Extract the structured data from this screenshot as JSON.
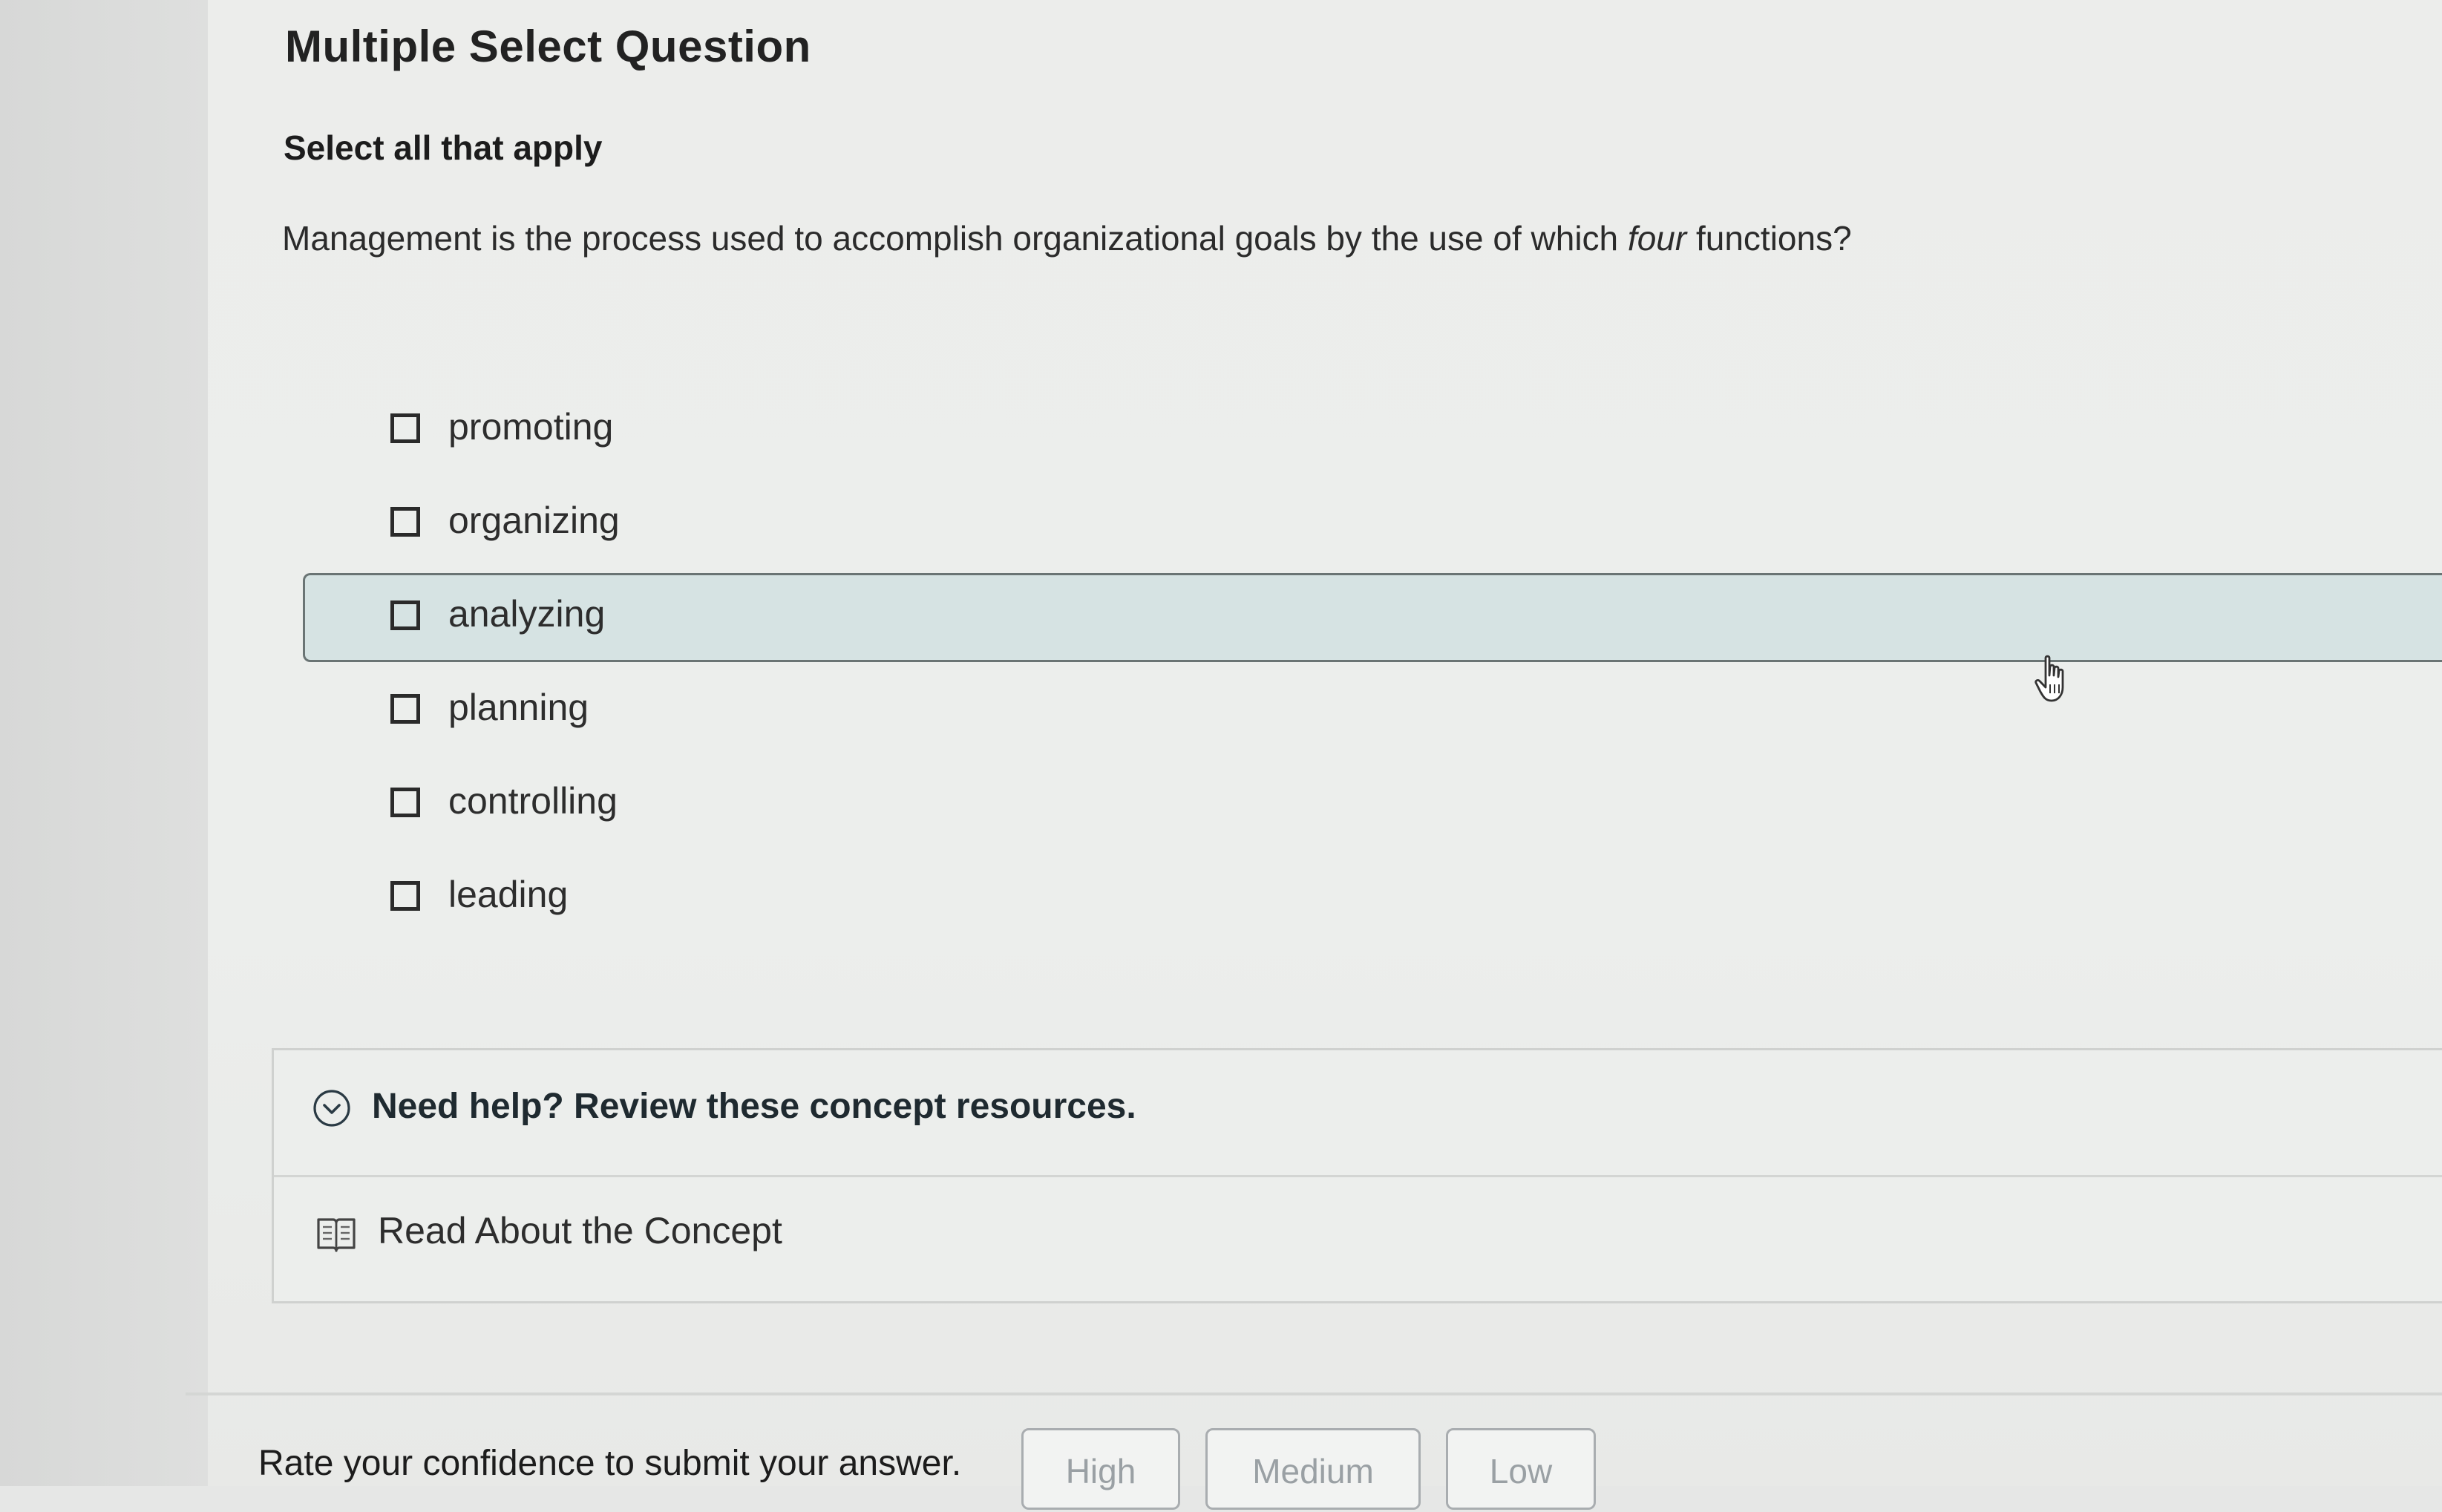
{
  "question": {
    "type_label": "Multiple Select Question",
    "instruction": "Select all that apply",
    "prompt_before": "Management is the process used to accomplish organizational goals by the use of which ",
    "prompt_emphasis": "four",
    "prompt_after": " functions?"
  },
  "options": [
    {
      "label": "promoting",
      "checked": false
    },
    {
      "label": "organizing",
      "checked": false
    },
    {
      "label": "analyzing",
      "checked": false,
      "hovered": true
    },
    {
      "label": "planning",
      "checked": false
    },
    {
      "label": "controlling",
      "checked": false
    },
    {
      "label": "leading",
      "checked": false
    }
  ],
  "help": {
    "title": "Need help? Review these concept resources.",
    "link_label": "Read About the Concept"
  },
  "confidence": {
    "label": "Rate your confidence to submit your answer.",
    "buttons": [
      "High",
      "Medium",
      "Low"
    ]
  },
  "colors": {
    "hover_row": "#d6e3e3",
    "hover_border": "#6a7474",
    "button_text": "#9aa0a4"
  }
}
